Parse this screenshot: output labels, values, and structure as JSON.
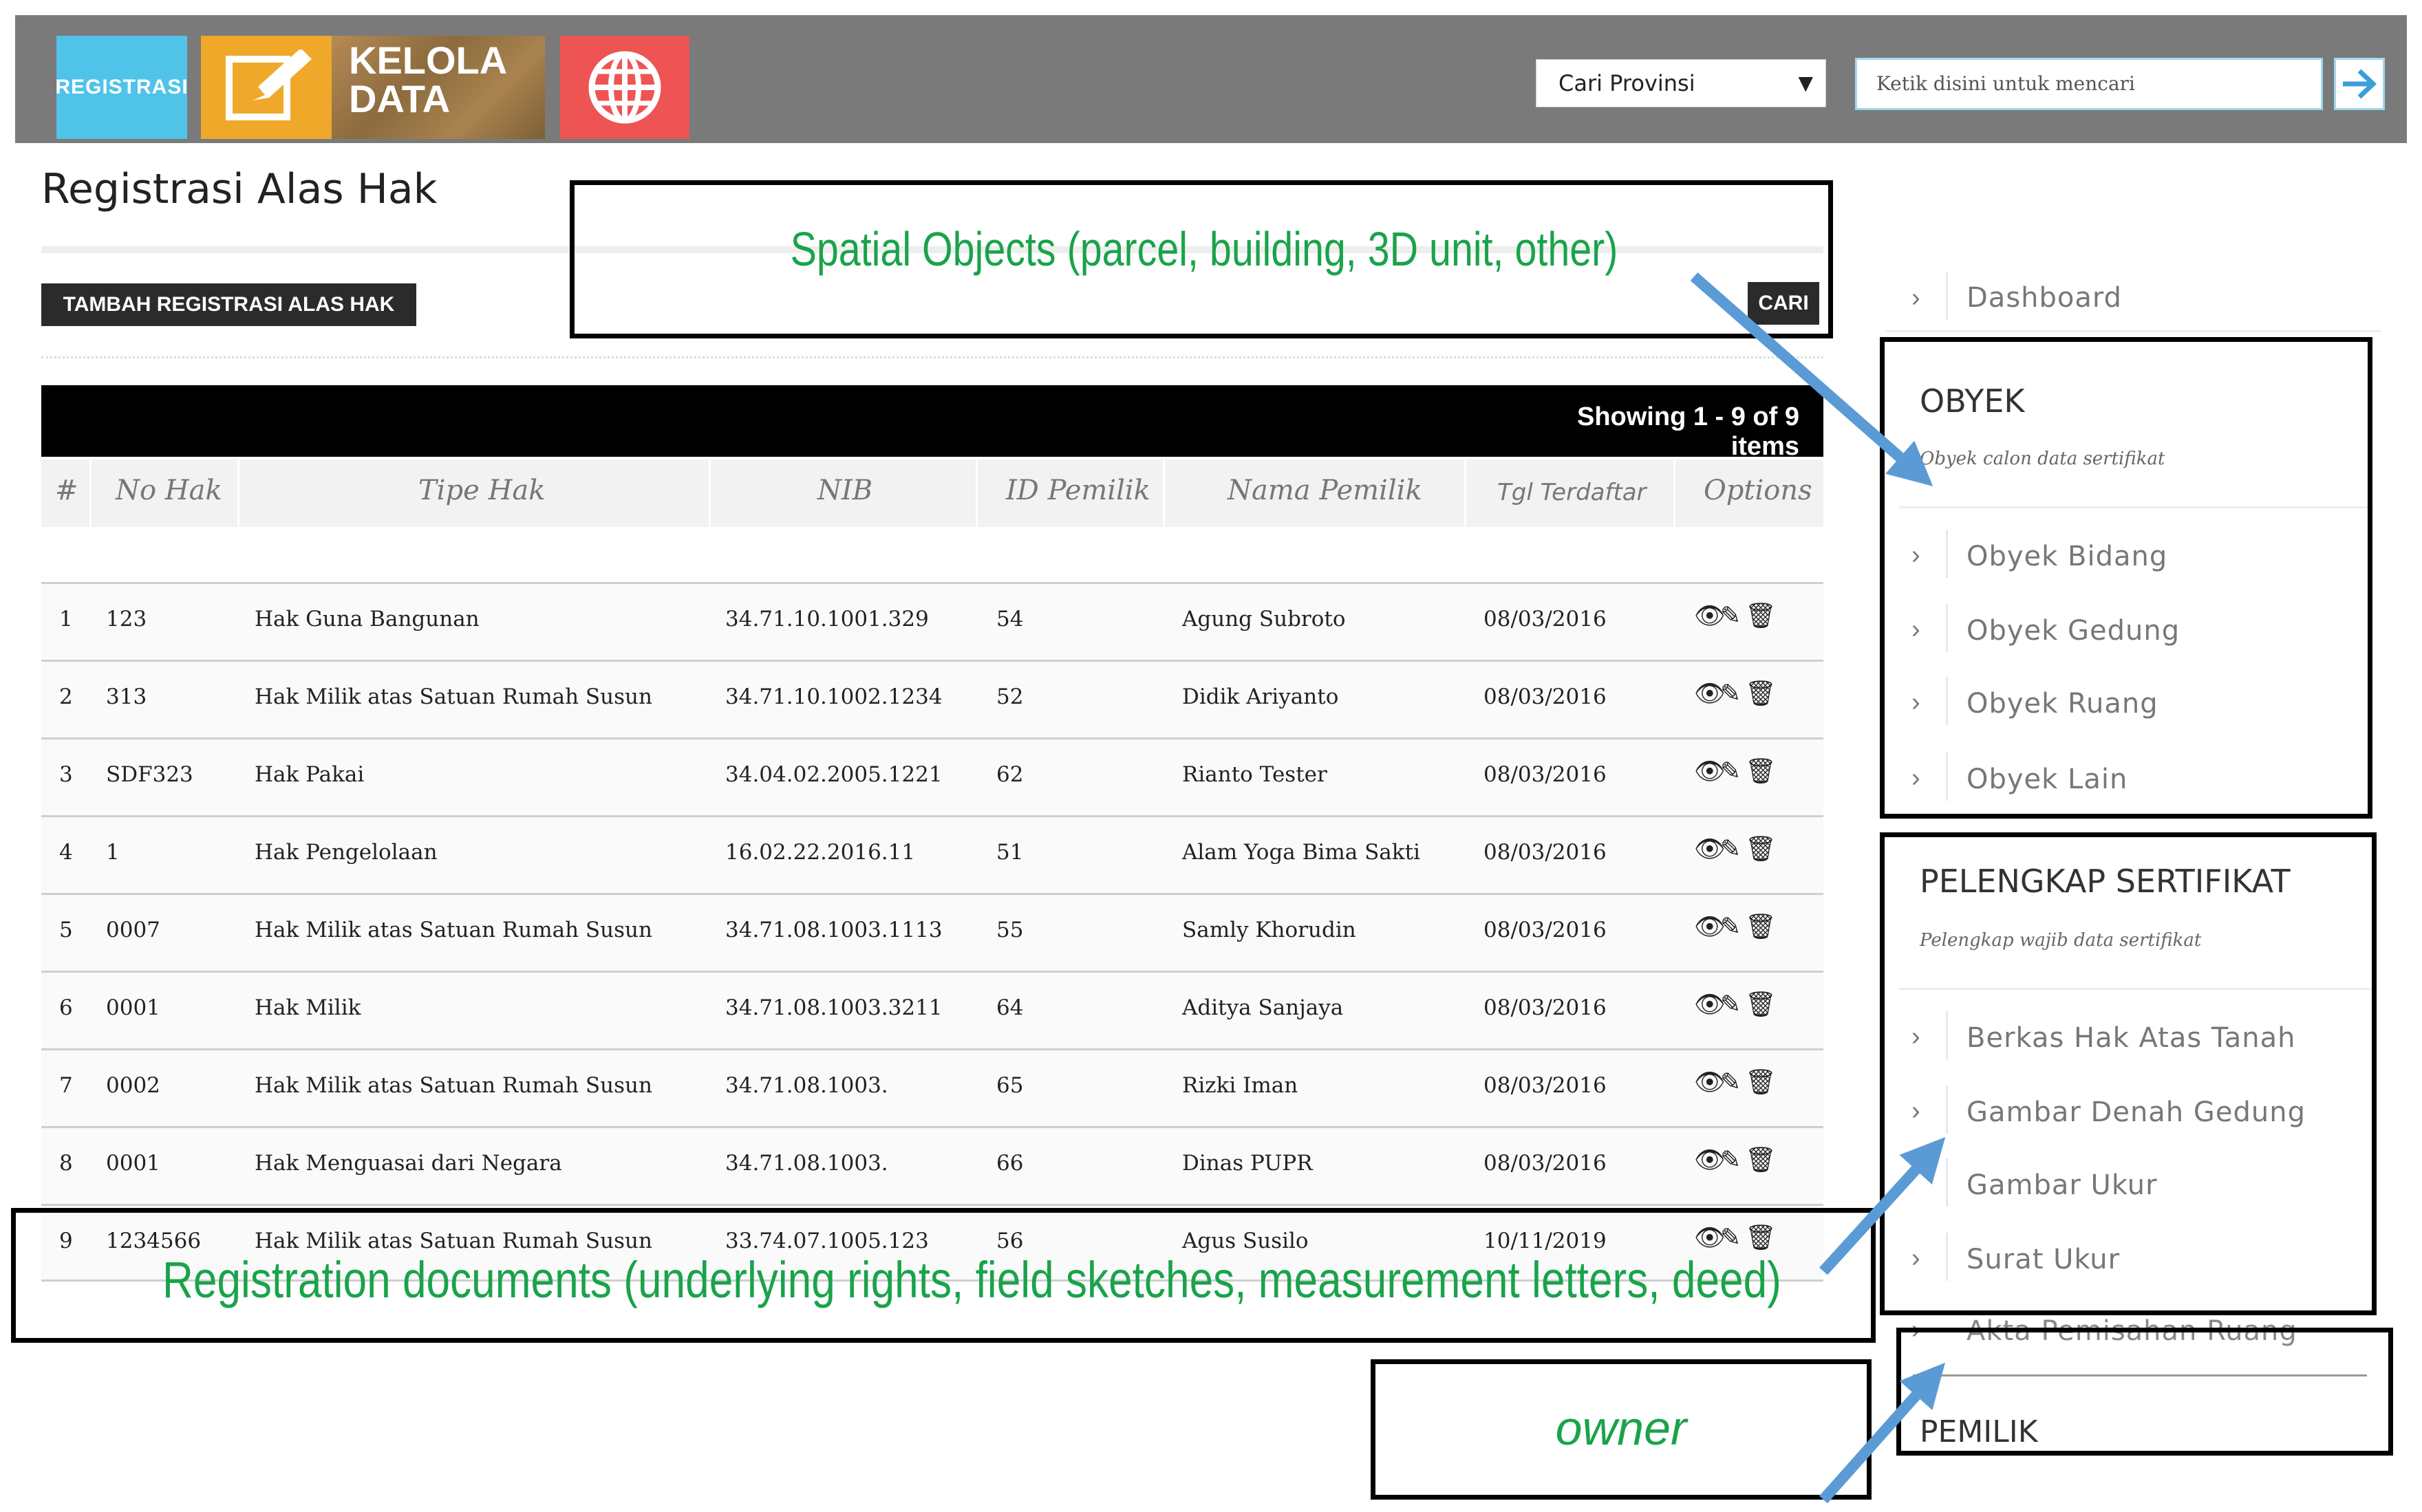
{
  "header": {
    "tiles": {
      "registrasi": "REGISTRASI",
      "kelola_line1": "KELOLA",
      "kelola_line2": "DATA"
    },
    "province_select": "Cari Provinsi",
    "search_placeholder": "Ketik disini untuk mencari"
  },
  "page": {
    "title": "Registrasi Alas Hak",
    "add_button": "TAMBAH REGISTRASI ALAS HAK",
    "search_button": "CARI",
    "showing": "Showing 1 - 9 of 9 items"
  },
  "table": {
    "columns": [
      "#",
      "No Hak",
      "Tipe Hak",
      "NIB",
      "ID Pemilik",
      "Nama Pemilik",
      "Tgl Terdaftar",
      "Options"
    ],
    "rows": [
      {
        "num": "1",
        "no_hak": "123",
        "tipe": "Hak Guna Bangunan",
        "nib": "34.71.10.1001.329",
        "id": "54",
        "nama": "Agung Subroto",
        "tgl": "08/03/2016"
      },
      {
        "num": "2",
        "no_hak": "313",
        "tipe": "Hak Milik atas Satuan Rumah Susun",
        "nib": "34.71.10.1002.1234",
        "id": "52",
        "nama": "Didik Ariyanto",
        "tgl": "08/03/2016"
      },
      {
        "num": "3",
        "no_hak": "SDF323",
        "tipe": "Hak Pakai",
        "nib": "34.04.02.2005.1221",
        "id": "62",
        "nama": "Rianto Tester",
        "tgl": "08/03/2016"
      },
      {
        "num": "4",
        "no_hak": "1",
        "tipe": "Hak Pengelolaan",
        "nib": "16.02.22.2016.11",
        "id": "51",
        "nama": "Alam Yoga Bima Sakti",
        "tgl": "08/03/2016"
      },
      {
        "num": "5",
        "no_hak": "0007",
        "tipe": "Hak Milik atas Satuan Rumah Susun",
        "nib": "34.71.08.1003.1113",
        "id": "55",
        "nama": "Samly Khorudin",
        "tgl": "08/03/2016"
      },
      {
        "num": "6",
        "no_hak": "0001",
        "tipe": "Hak Milik",
        "nib": "34.71.08.1003.3211",
        "id": "64",
        "nama": "Aditya Sanjaya",
        "tgl": "08/03/2016"
      },
      {
        "num": "7",
        "no_hak": "0002",
        "tipe": "Hak Milik atas Satuan Rumah Susun",
        "nib": "34.71.08.1003.",
        "id": "65",
        "nama": "Rizki Iman",
        "tgl": "08/03/2016"
      },
      {
        "num": "8",
        "no_hak": "0001",
        "tipe": "Hak Menguasai dari Negara",
        "nib": "34.71.08.1003.",
        "id": "66",
        "nama": "Dinas PUPR",
        "tgl": "08/03/2016"
      },
      {
        "num": "9",
        "no_hak": "1234566",
        "tipe": "Hak Milik atas Satuan Rumah Susun",
        "nib": "33.74.07.1005.123",
        "id": "56",
        "nama": "Agus Susilo",
        "tgl": "10/11/2019"
      }
    ]
  },
  "sidebar": {
    "dashboard": "Dashboard",
    "obyek": {
      "title": "OBYEK",
      "subtitle": "Obyek calon data sertifikat",
      "items": [
        "Obyek Bidang",
        "Obyek Gedung",
        "Obyek Ruang",
        "Obyek Lain"
      ]
    },
    "pelengkap": {
      "title": "PELENGKAP SERTIFIKAT",
      "subtitle": "Pelengkap wajib data sertifikat",
      "items": [
        "Berkas Hak Atas Tanah",
        "Gambar Denah Gedung",
        "Gambar Ukur",
        "Surat Ukur",
        "Akta Pemisahan Ruang"
      ]
    },
    "pemilik": {
      "title": "PEMILIK"
    }
  },
  "annotations": {
    "spatial": "Spatial Objects (parcel, building, 3D unit, other)",
    "registration": "Registration documents (underlying rights, field sketches, measurement letters, deed)",
    "owner": "owner"
  },
  "colors": {
    "annotation_green": "#1aa34a",
    "arrow_blue": "#5b9bd5",
    "header_gray": "#7a7a7a",
    "tile_blue": "#4fc3e8",
    "tile_orange": "#f0a82a",
    "tile_red": "#ee5454"
  }
}
